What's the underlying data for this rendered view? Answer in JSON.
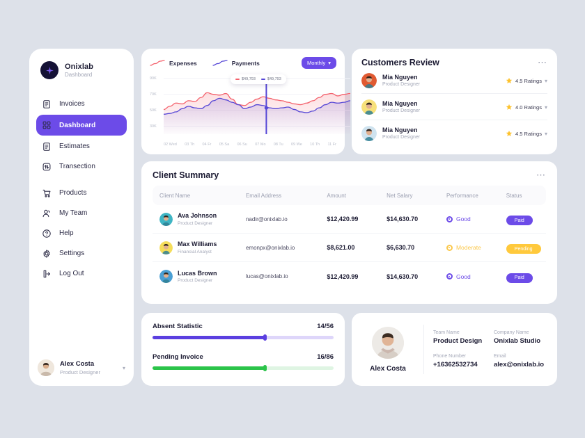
{
  "brand": {
    "name": "Onixlab",
    "subtitle": "Dashboard",
    "logo_icon": "star-sparkle-icon"
  },
  "sidebar": {
    "items": [
      {
        "label": "Invoices",
        "icon": "document-icon",
        "active": false
      },
      {
        "label": "Dashboard",
        "icon": "grid-icon",
        "active": true
      },
      {
        "label": "Estimates",
        "icon": "document-icon",
        "active": false
      },
      {
        "label": "Transection",
        "icon": "transfer-icon",
        "active": false
      },
      {
        "label": "Products",
        "icon": "cart-icon",
        "active": false
      },
      {
        "label": "My Team",
        "icon": "users-icon",
        "active": false
      },
      {
        "label": "Help",
        "icon": "question-circle-icon",
        "active": false
      },
      {
        "label": "Settings",
        "icon": "gear-icon",
        "active": false
      },
      {
        "label": "Log Out",
        "icon": "logout-icon",
        "active": false
      }
    ],
    "profile": {
      "name": "Alex Costa",
      "role": "Product Designer",
      "chevron": "chevron-down-icon"
    }
  },
  "chart_card": {
    "legend": [
      {
        "label": "Expenses",
        "color": "#f4616c"
      },
      {
        "label": "Payments",
        "color": "#5546d6"
      }
    ],
    "range_button": {
      "label": "Monthly",
      "icon": "chevron-down-icon"
    },
    "tooltip": [
      {
        "value": "$49,793",
        "color": "#f4616c"
      },
      {
        "value": "$49,793",
        "color": "#5546d6"
      }
    ]
  },
  "chart_data": {
    "type": "area",
    "title": "",
    "xlabel": "",
    "ylabel": "",
    "ylim": [
      20000,
      95000
    ],
    "yticks": [
      "30K",
      "50K",
      "70K",
      "90K"
    ],
    "ytick_values": [
      30000,
      50000,
      70000,
      90000
    ],
    "categories": [
      "02 Wed",
      "03 Th",
      "04 Fr",
      "05 Sa",
      "06 Su",
      "07 Mo",
      "08 Tu",
      "09 We",
      "10 Th",
      "11 Fr"
    ],
    "grid": true,
    "legend_position": "top-left",
    "marker_x": "07 Mo",
    "series": [
      {
        "name": "Expenses",
        "color": "#f4616c",
        "values": [
          51000,
          55000,
          59000,
          58000,
          62000,
          61000,
          66000,
          72000,
          70000,
          69000,
          71000,
          64000,
          57000,
          56000,
          60000,
          64000,
          67000,
          65000,
          63000,
          62000,
          60000,
          58000,
          57000,
          59000,
          62000,
          66000,
          70000,
          71000,
          68000,
          70000,
          71000
        ]
      },
      {
        "name": "Payments",
        "color": "#5546d6",
        "values": [
          45000,
          46000,
          48000,
          52000,
          55000,
          53000,
          52000,
          56000,
          62000,
          65000,
          63000,
          60000,
          57000,
          52000,
          54000,
          57000,
          56000,
          53000,
          52000,
          53000,
          54000,
          51000,
          48000,
          47000,
          49000,
          53000,
          57000,
          60000,
          59000,
          60000,
          62000
        ]
      }
    ]
  },
  "reviews": {
    "title": "Customers Review",
    "menu_icon": "more-horizontal-icon",
    "items": [
      {
        "name": "Mia Nguyen",
        "role": "Product Designer",
        "rating": "4.5 Ratings",
        "avatar_color": "#e05a32"
      },
      {
        "name": "Mia Nguyen",
        "role": "Product Designer",
        "rating": "4.0 Ratings",
        "avatar_color": "#f7e07a"
      },
      {
        "name": "Mia Nguyen",
        "role": "Product Designer",
        "rating": "4.5 Ratings",
        "avatar_color": "#cfe3ef"
      }
    ]
  },
  "summary": {
    "title": "Client Summary",
    "menu_icon": "more-horizontal-icon",
    "columns": [
      "Client Name",
      "Email Address",
      "Amount",
      "Net Salary",
      "Performance",
      "Status"
    ],
    "rows": [
      {
        "name": "Ava Johnson",
        "role": "Product Designer",
        "email": "nadir@onixlab.io",
        "amount": "$12,420.99",
        "net_salary": "$14,630.70",
        "performance": "Good",
        "performance_color": "#6c4be8",
        "status": "Paid",
        "status_color": "#6c4be8",
        "avatar_color": "#3fb5c4"
      },
      {
        "name": "Max Williams",
        "role": "Financial Analyst",
        "email": "emonpx@onixlab.io",
        "amount": "$8,621.00",
        "net_salary": "$6,630.70",
        "performance": "Moderate",
        "performance_color": "#fbc84b",
        "status": "Pending",
        "status_color": "#ffc93c",
        "avatar_color": "#f5dd5a"
      },
      {
        "name": "Lucas Brown",
        "role": "Product Designer",
        "email": "lucas@onixlab.io",
        "amount": "$12,420.99",
        "net_salary": "$14,630.70",
        "performance": "Good",
        "performance_color": "#6c4be8",
        "status": "Paid",
        "status_color": "#6c4be8",
        "avatar_color": "#4a9fd4"
      }
    ]
  },
  "stats": [
    {
      "label": "Absent Statistic",
      "value": "14/56",
      "percent": 62,
      "color": "#5b3fe0",
      "track": "#ded6fa"
    },
    {
      "label": "Pending Invoice",
      "value": "16/86",
      "percent": 62,
      "color": "#2bc44a",
      "track": "#dff5e3"
    }
  ],
  "profile_card": {
    "name": "Alex Costa",
    "fields": [
      {
        "label": "Team Name",
        "value": "Product Design"
      },
      {
        "label": "Company Name",
        "value": "Onixlab Studio"
      },
      {
        "label": "Phone Number",
        "value": "+16362532734"
      },
      {
        "label": "Email",
        "value": "alex@onixlab.io"
      }
    ]
  }
}
